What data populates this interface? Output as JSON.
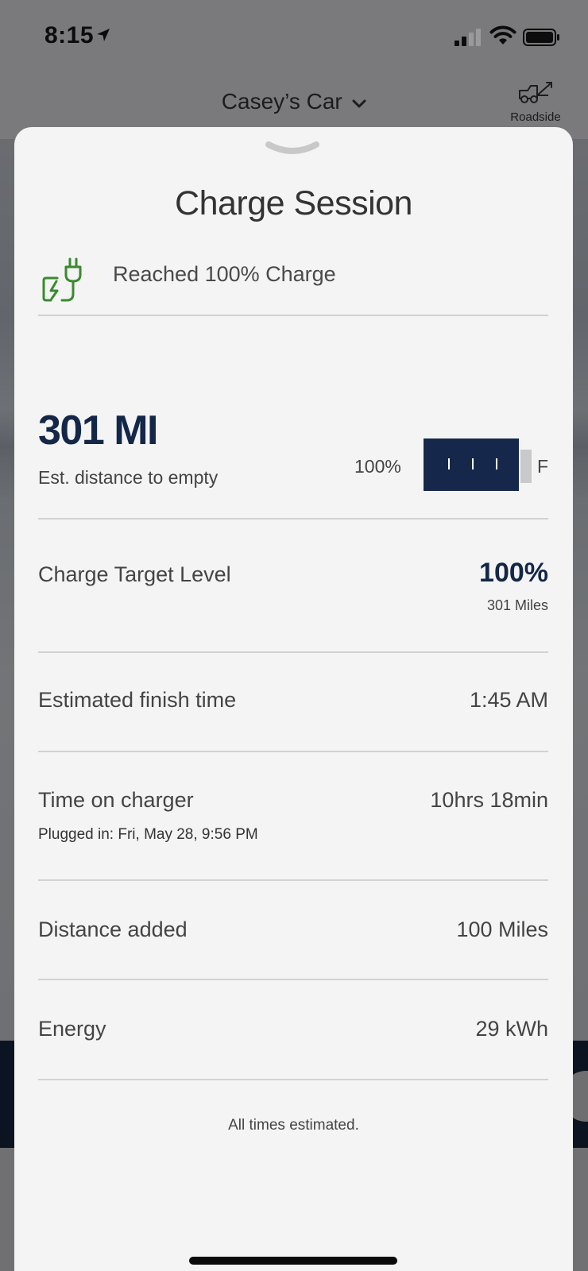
{
  "status_bar": {
    "time": "8:15"
  },
  "header": {
    "title": "Casey’s Car",
    "roadside_label": "Roadside"
  },
  "sheet": {
    "title": "Charge Session",
    "status_text": "Reached 100% Charge",
    "range_value": "301 MI",
    "range_label": "Est. distance to empty",
    "battery_percent_label": "100%",
    "battery_level": 1.0,
    "battery_end_label": "F",
    "charge_target": {
      "label": "Charge Target Level",
      "value": "100%",
      "sub": "301 Miles"
    },
    "finish_time": {
      "label": "Estimated finish time",
      "value": "1:45 AM"
    },
    "time_on_charger": {
      "label": "Time on charger",
      "sub": "Plugged in: Fri, May 28, 9:56 PM",
      "value": "10hrs 18min"
    },
    "distance_added": {
      "label": "Distance added",
      "value": "100 Miles"
    },
    "energy": {
      "label": "Energy",
      "value": "29 kWh"
    },
    "footnote": "All times estimated."
  },
  "colors": {
    "brand_navy": "#142748",
    "charge_green": "#3a8a2f",
    "sheet_bg": "#f4f4f4"
  }
}
